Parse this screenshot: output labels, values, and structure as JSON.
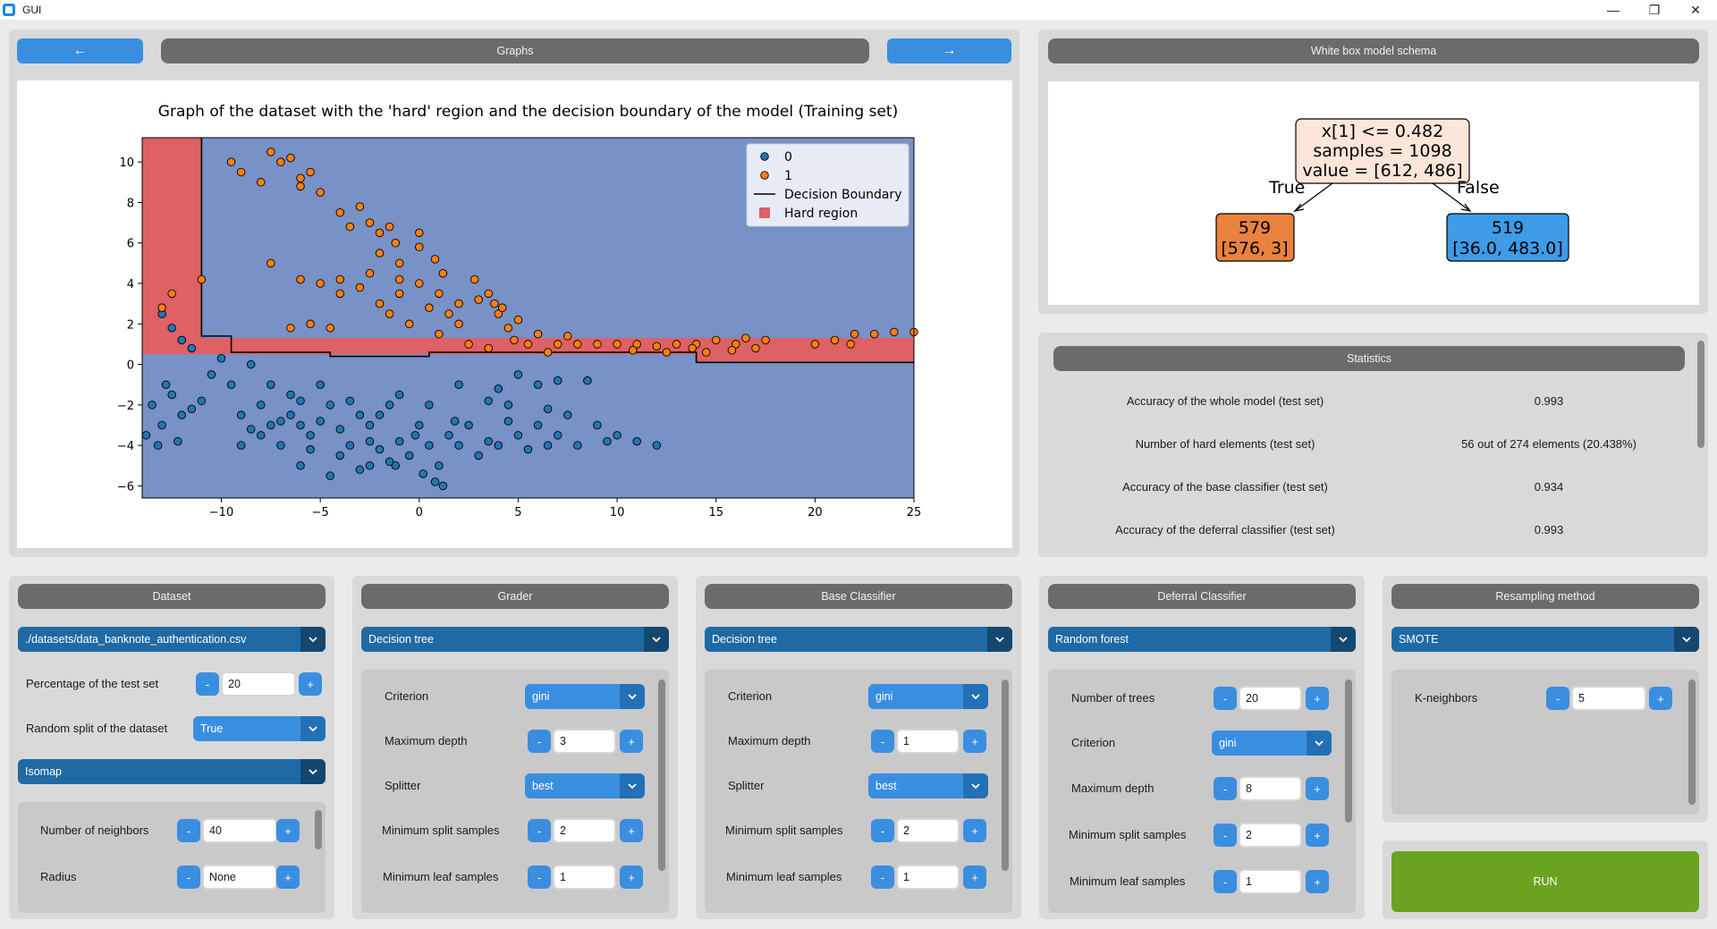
{
  "window": {
    "title": "GUI"
  },
  "nav": {
    "prev_label": "←",
    "next_label": "→",
    "graphs_label": "Graphs"
  },
  "chart_data": {
    "type": "scatter",
    "title": "Graph of the dataset with the 'hard' region and the decision boundary of the model (Training set)",
    "xlim": [
      -14,
      25
    ],
    "ylim": [
      -6.6,
      11.2
    ],
    "x_ticks": [
      -10,
      -5,
      0,
      5,
      10,
      15,
      20,
      25
    ],
    "y_ticks": [
      -6,
      -4,
      -2,
      0,
      2,
      4,
      6,
      8,
      10
    ],
    "legend": {
      "placement": "top-right",
      "entries": [
        "0",
        "1",
        "Decision Boundary",
        "Hard region"
      ]
    },
    "colors": {
      "class0": "#1f77b4",
      "class1": "#ff7f0e",
      "background": "#7891c6",
      "hard": "#dd6165"
    },
    "series": [
      {
        "name": "0",
        "points": [
          [
            -13.5,
            -2
          ],
          [
            -13,
            -3
          ],
          [
            -12.5,
            -1.5
          ],
          [
            -12,
            -2.5
          ],
          [
            -11.5,
            -2.2
          ],
          [
            -13.2,
            -4
          ],
          [
            -12.8,
            -1
          ],
          [
            -11,
            -1.8
          ],
          [
            -10,
            0.3
          ],
          [
            -9.5,
            -1
          ],
          [
            -9,
            -2.5
          ],
          [
            -8.5,
            -3.2
          ],
          [
            -8,
            -3.5
          ],
          [
            -7.5,
            -3
          ],
          [
            -7,
            -4
          ],
          [
            -6.5,
            -2.5
          ],
          [
            -6,
            -3
          ],
          [
            -5.5,
            -3.5
          ],
          [
            -5,
            -2.8
          ],
          [
            -4.5,
            -2
          ],
          [
            -4,
            -3.2
          ],
          [
            -3.5,
            -4
          ],
          [
            -3,
            -2.5
          ],
          [
            -2.5,
            -3
          ],
          [
            -2,
            -4.2
          ],
          [
            -1.5,
            -2
          ],
          [
            -1,
            -3.8
          ],
          [
            -0.5,
            -4.5
          ],
          [
            0,
            -3
          ],
          [
            0.5,
            -4
          ],
          [
            1,
            -5
          ],
          [
            1.5,
            -3.5
          ],
          [
            2,
            -4
          ],
          [
            2.5,
            -3
          ],
          [
            3,
            -4.5
          ],
          [
            3.5,
            -3.8
          ],
          [
            4,
            -4
          ],
          [
            4.5,
            -2.8
          ],
          [
            5,
            -3.5
          ],
          [
            5.5,
            -4.2
          ],
          [
            6,
            -3
          ],
          [
            6.5,
            -4
          ],
          [
            7,
            -3.5
          ],
          [
            7.5,
            -2.5
          ],
          [
            8,
            -4
          ],
          [
            9,
            -3
          ],
          [
            10,
            -3.5
          ],
          [
            11,
            -3.8
          ],
          [
            12,
            -4
          ],
          [
            -11.5,
            0.8
          ],
          [
            -12.5,
            1.8
          ],
          [
            -13,
            2.5
          ],
          [
            -12,
            1.2
          ],
          [
            -10.5,
            -0.5
          ],
          [
            -8.5,
            0
          ],
          [
            -7.5,
            -1
          ],
          [
            -6.5,
            -1.5
          ],
          [
            -5,
            -1
          ],
          [
            -3.5,
            -1.8
          ],
          [
            -2,
            -2.5
          ],
          [
            -1,
            -1.5
          ],
          [
            0.5,
            -2
          ],
          [
            2,
            -1
          ],
          [
            4,
            -1.2
          ],
          [
            5,
            -0.5
          ],
          [
            6,
            -1
          ],
          [
            7,
            -0.8
          ],
          [
            8.5,
            -0.8
          ],
          [
            -6,
            -5
          ],
          [
            -4.5,
            -5.5
          ],
          [
            -3,
            -5.2
          ],
          [
            0.8,
            -5.8
          ],
          [
            -1.2,
            -5
          ],
          [
            0.2,
            -5.4
          ],
          [
            1.2,
            -6
          ],
          [
            -2.5,
            -5
          ],
          [
            3.5,
            -1.8
          ],
          [
            4.5,
            -2
          ],
          [
            6.5,
            -2.2
          ],
          [
            9.5,
            -3.8
          ],
          [
            -13.8,
            -3.5
          ],
          [
            -12.2,
            -3.8
          ],
          [
            -9,
            -4
          ],
          [
            -8,
            -2
          ],
          [
            -7,
            -2.8
          ],
          [
            -6,
            -1.8
          ],
          [
            -5.5,
            -4.2
          ],
          [
            -4,
            -4.5
          ],
          [
            -2.5,
            -3.8
          ],
          [
            -1.5,
            -4.8
          ],
          [
            -0.2,
            -3.5
          ],
          [
            1.8,
            -2.8
          ]
        ]
      },
      {
        "name": "1",
        "points": [
          [
            -13,
            2.8
          ],
          [
            -12.5,
            3.5
          ],
          [
            -11,
            4.2
          ],
          [
            -9.5,
            10
          ],
          [
            -9,
            9.5
          ],
          [
            -8,
            9
          ],
          [
            -7.5,
            10.5
          ],
          [
            -7,
            10
          ],
          [
            -6.5,
            10.2
          ],
          [
            -6,
            9.2
          ],
          [
            -5,
            8.5
          ],
          [
            -4,
            7.5
          ],
          [
            -3,
            7.8
          ],
          [
            -2.5,
            7
          ],
          [
            -2,
            6.5
          ],
          [
            -1.5,
            6.8
          ],
          [
            -1,
            5
          ],
          [
            0,
            6.5
          ],
          [
            0,
            5.8
          ],
          [
            -7.5,
            5
          ],
          [
            -5,
            4
          ],
          [
            -6,
            4.2
          ],
          [
            -4,
            3.5
          ],
          [
            -3,
            3.8
          ],
          [
            -2,
            3
          ],
          [
            -1,
            3.5
          ],
          [
            0,
            4
          ],
          [
            1,
            3.5
          ],
          [
            1.5,
            2.5
          ],
          [
            2,
            3
          ],
          [
            3,
            3.2
          ],
          [
            4,
            2.5
          ],
          [
            4.5,
            1.8
          ],
          [
            5,
            2.2
          ],
          [
            2.5,
            1
          ],
          [
            3.5,
            0.8
          ],
          [
            5.5,
            1
          ],
          [
            6,
            1.5
          ],
          [
            7,
            1
          ],
          [
            8,
            1
          ],
          [
            9,
            1
          ],
          [
            10,
            1
          ],
          [
            11,
            1
          ],
          [
            12,
            0.9
          ],
          [
            13,
            1
          ],
          [
            14,
            1
          ],
          [
            15,
            1.2
          ],
          [
            16,
            1
          ],
          [
            17,
            0.8
          ],
          [
            17.5,
            1.2
          ],
          [
            20,
            1
          ],
          [
            21,
            1.2
          ],
          [
            22,
            1.5
          ],
          [
            23,
            1.5
          ],
          [
            24,
            1.6
          ],
          [
            25,
            1.6
          ],
          [
            -4.5,
            1.8
          ],
          [
            -5.5,
            2
          ],
          [
            -6.5,
            1.8
          ],
          [
            -1.5,
            2.5
          ],
          [
            -0.5,
            2
          ],
          [
            1,
            1.5
          ],
          [
            3.5,
            3.5
          ],
          [
            4.2,
            2.8
          ],
          [
            4.8,
            1.2
          ],
          [
            6.5,
            0.6
          ],
          [
            7.5,
            1.4
          ],
          [
            10.8,
            0.7
          ],
          [
            12.5,
            0.6
          ],
          [
            13.8,
            0.8
          ],
          [
            14.5,
            0.6
          ],
          [
            15.8,
            0.7
          ],
          [
            16.5,
            1.3
          ],
          [
            21.8,
            1
          ],
          [
            -4,
            4.2
          ],
          [
            -2.5,
            4.5
          ],
          [
            -1,
            4.2
          ],
          [
            0.5,
            2.8
          ],
          [
            2,
            2
          ],
          [
            -5.5,
            9.5
          ],
          [
            -6,
            8.8
          ],
          [
            -3.5,
            6.8
          ],
          [
            -2,
            5.5
          ],
          [
            -1.2,
            6
          ],
          [
            0.8,
            5.2
          ],
          [
            1.2,
            4.5
          ],
          [
            2.8,
            4.2
          ],
          [
            3.8,
            3
          ]
        ]
      }
    ]
  },
  "schema": {
    "title": "White box model schema",
    "root": {
      "line1": "x[1] <= 0.482",
      "line2": "samples = 1098",
      "line3": "value = [612, 486]"
    },
    "true_label": "True",
    "false_label": "False",
    "left": {
      "line1": "579",
      "line2": "[576, 3]"
    },
    "right": {
      "line1": "519",
      "line2": "[36.0, 483.0]"
    }
  },
  "statistics": {
    "title": "Statistics",
    "rows": [
      {
        "label": "Accuracy of the whole model (test set)",
        "value": "0.993"
      },
      {
        "label": "Number of hard elements (test set)",
        "value": "56 out of 274 elements (20.438%)"
      },
      {
        "label": "Accuracy of the base classifier (test set)",
        "value": "0.934"
      },
      {
        "label": "Accuracy of the deferral classifier (test set)",
        "value": "0.993"
      }
    ]
  },
  "dataset": {
    "title": "Dataset",
    "file": "./datasets/data_banknote_authentication.csv",
    "test_pct_label": "Percentage of the test set",
    "test_pct_value": "20",
    "random_split_label": "Random split of the dataset",
    "random_split_value": "True",
    "reduction": "Isomap",
    "neighbors_label": "Number of neighbors",
    "neighbors_value": "40",
    "radius_label": "Radius",
    "radius_value": "None"
  },
  "grader": {
    "title": "Grader",
    "model": "Decision tree",
    "criterion_label": "Criterion",
    "criterion": "gini",
    "max_depth_label": "Maximum depth",
    "max_depth": "3",
    "splitter_label": "Splitter",
    "splitter": "best",
    "min_split_label": "Minimum split samples",
    "min_split": "2",
    "min_leaf_label": "Minimum leaf samples",
    "min_leaf": "1"
  },
  "base": {
    "title": "Base Classifier",
    "model": "Decision tree",
    "criterion_label": "Criterion",
    "criterion": "gini",
    "max_depth_label": "Maximum depth",
    "max_depth": "1",
    "splitter_label": "Splitter",
    "splitter": "best",
    "min_split_label": "Minimum split samples",
    "min_split": "2",
    "min_leaf_label": "Minimum leaf samples",
    "min_leaf": "1"
  },
  "deferral": {
    "title": "Deferral Classifier",
    "model": "Random forest",
    "trees_label": "Number of trees",
    "trees": "20",
    "criterion_label": "Criterion",
    "criterion": "gini",
    "max_depth_label": "Maximum depth",
    "max_depth": "8",
    "min_split_label": "Minimum split samples",
    "min_split": "2",
    "min_leaf_label": "Minimum leaf samples",
    "min_leaf": "1"
  },
  "resampling": {
    "title": "Resampling method",
    "method": "SMOTE",
    "k_label": "K-neighbors",
    "k": "5"
  },
  "run_label": "RUN",
  "stepper": {
    "minus": "-",
    "plus": "+"
  }
}
